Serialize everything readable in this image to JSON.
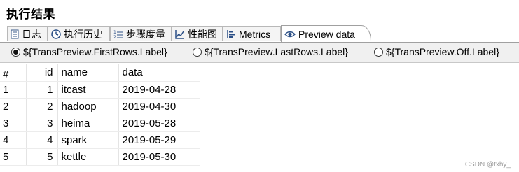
{
  "panel": {
    "title": "执行结果"
  },
  "tabs": [
    {
      "label": "日志",
      "icon": "log-icon"
    },
    {
      "label": "执行历史",
      "icon": "history-icon"
    },
    {
      "label": "步骤度量",
      "icon": "step-metrics-icon"
    },
    {
      "label": "性能图",
      "icon": "performance-chart-icon"
    },
    {
      "label": "Metrics",
      "icon": "metrics-icon"
    },
    {
      "label": "Preview data",
      "icon": "eye-icon",
      "active": true
    }
  ],
  "preview_options": {
    "first_rows": "${TransPreview.FirstRows.Label}",
    "last_rows": "${TransPreview.LastRows.Label}",
    "off": "${TransPreview.Off.Label}",
    "selected": "first_rows"
  },
  "table": {
    "headers": {
      "row_num": "#",
      "id": "id",
      "name": "name",
      "data": "data"
    },
    "rows": [
      {
        "n": "1",
        "id": "1",
        "name": "itcast",
        "data": "2019-04-28"
      },
      {
        "n": "2",
        "id": "2",
        "name": "hadoop",
        "data": "2019-04-30"
      },
      {
        "n": "3",
        "id": "3",
        "name": "heima",
        "data": "2019-05-28"
      },
      {
        "n": "4",
        "id": "4",
        "name": "spark",
        "data": "2019-05-29"
      },
      {
        "n": "5",
        "id": "5",
        "name": "kettle",
        "data": "2019-05-30"
      }
    ]
  },
  "watermark": "CSDN @txhy_"
}
